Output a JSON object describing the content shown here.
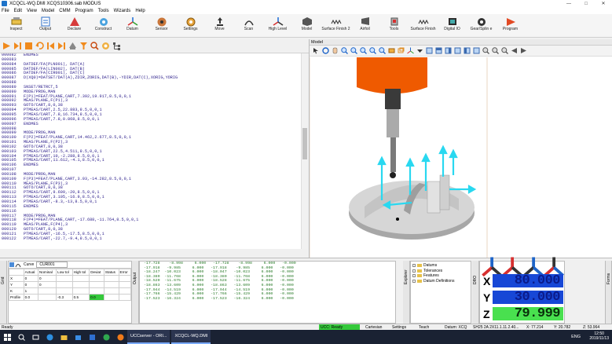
{
  "window": {
    "title": "XCQCL-WQ.DMI   XCQS10306.sab   MODUS",
    "minimize": "—",
    "maximize": "□",
    "close": "✕"
  },
  "menu": [
    "File",
    "Edit",
    "View",
    "Model",
    "CMM",
    "Program",
    "Tools",
    "Wizards",
    "Help"
  ],
  "ribbon": [
    {
      "label": "Inspect",
      "icon": "inspect-icon"
    },
    {
      "label": "Output",
      "icon": "output-icon"
    },
    {
      "label": "Declare",
      "icon": "declare-icon"
    },
    {
      "label": "Construct",
      "icon": "construct-icon"
    },
    {
      "label": "Datum",
      "icon": "datum-icon"
    },
    {
      "label": "Sensor",
      "icon": "sensor-icon"
    },
    {
      "label": "Settings",
      "icon": "settings-icon"
    },
    {
      "label": "Move",
      "icon": "move-icon"
    },
    {
      "label": "Scan",
      "icon": "scan-icon"
    },
    {
      "label": "High Level",
      "icon": "high-level-icon"
    },
    {
      "label": "Model",
      "icon": "model-icon"
    },
    {
      "label": "Surface Finish 2",
      "icon": "surface-finish-2-icon"
    },
    {
      "label": "Airfoil",
      "icon": "airfoil-icon"
    },
    {
      "label": "Tools",
      "icon": "tools-icon"
    },
    {
      "label": "Surface Finish",
      "icon": "surface-finish-icon"
    },
    {
      "label": "Digital IO",
      "icon": "digital-io-icon"
    },
    {
      "label": "Gear/Splin e",
      "icon": "gear-spline-icon"
    },
    {
      "label": "Program",
      "icon": "program-icon"
    }
  ],
  "editor": {
    "lines": [
      "000082   ENDMES",
      "000083",
      "000084   DATDEF/FA(PLN001), DAT(A)",
      "000085   DATDEF/FA(LIN002), DAT(B)",
      "000086   DATDEF/FA(CIR001), DAT(C)",
      "000087   D(XQ0)=DATSET/DAT(A),ZDIR,ZORIG,DAT(B),-YDIR,DAT(C),XORIG,YORIG",
      "000088",
      "000089   SNSET/RETRCT,5",
      "000090   MODE/PROG,MAN",
      "000091   F(P1)=FEAT/PLANE,CART,7.392,19.917,8.5,0,0,1",
      "000092   MEAS/PLANE,F(P1),3",
      "000093   GOTO/CART,8,0,38",
      "000094   PTMEAS/CART,2.5,22.883,8.5,0,0,1",
      "000095   PTMEAS/CART,7.8,16.734,8.5,0,0,1",
      "000096   PTMEAS/CART,7.8,0.868,8.5,0,0,1",
      "000097   ENDMES",
      "000098",
      "000099   MODE/PROG,MAN",
      "000100   F(P2)=FEAT/PLANE,CART,14.462,2.677,8.5,0,0,1",
      "000101   MEAS/PLANE,F(P2),3",
      "000102   GOTO/CART,8,0,38",
      "000103   PTMEAS/CART,22.5,4.511,8.5,0,0,1",
      "000104   PTMEAS/CART,10,-2.288,8.5,0,0,1",
      "000105   PTMEAS/CART,11.612,-4.1,8.5,0,0,1",
      "000106   ENDMES",
      "000107",
      "000108   MODE/PROG,MAN",
      "000109   F(P3)=FEAT/PLANE,CART,3.93,-14.282,8.5,0,0,1",
      "000110   MEAS/PLANE,F(P3),3",
      "000111   GOTO/CART,8,0,38",
      "000112   PTMEAS/CART,9.609,-20,8.5,0,0,1",
      "000113   PTMEAS/CART,3.105,-16.9,8.5,0,0,1",
      "000114   PTMEAS/CART,-8.3,-13,8.5,0,0,1",
      "000115   ENDMES",
      "000116",
      "000117   MODE/PROG,MAN",
      "000118   F(P4)=FEAT/PLANE,CART,-17.688,-11.764,8.5,0,0,1",
      "000119   MEAS/PLANE,F(P4),3",
      "000120   GOTO/CART,8,0,38",
      "000121   PTMEAS/CART,-16.5,-17.5,8.5,0,0,1",
      "000122   PTMEAS/CART,-22.7,-9.4,8.5,0,0,1"
    ]
  },
  "model": {
    "panel_title": "Model"
  },
  "grid": {
    "curve_label": "Curve",
    "curve_value": "CUR001",
    "columns": [
      "",
      "Actual",
      "Nominal",
      "Low tol",
      "High tol",
      "Deviat",
      "Status",
      "Error"
    ],
    "rows": [
      {
        "name": "X",
        "actual": "0",
        "nominal": "0"
      },
      {
        "name": "Y",
        "actual": "0",
        "nominal": "0"
      },
      {
        "name": "K",
        "actual": "1",
        "nominal": ""
      },
      {
        "name": "Profile",
        "actual": "0.0",
        "nominal": "",
        "low": "-0.3",
        "high": "0.5",
        "deviat": "0.0"
      }
    ],
    "side_tab": "Grid"
  },
  "output": {
    "side_tab": "Output",
    "rows": [
      "-17.728    -8.998     6.000   -17.728    -8.998     6.000   -0.000",
      "-17.918   -9.985     6.000   -17.918    -9.985     6.000   -0.000",
      "-18.247  -10.023     6.000   -18.047   -10.023     6.000   -0.000",
      "-18.380  -11.768     6.000   -18.380   -11.768     6.000   -0.000",
      "-18.520  -11.675     6.000   -18.528   -11.675     6.000   -0.000",
      "-18.863  -13.609     6.000   -18.863   -13.609     6.000   -0.000",
      "-17.944  -14.519     6.000   -17.944   -14.519     6.000   -0.000",
      "-17.766  -15.429     6.000   -17.766   -15.429     6.000   -0.000",
      "-17.523  -16.324     6.000   -17.523   -16.324     6.000   -0.000"
    ]
  },
  "explorer": {
    "side_tab": "Explorer",
    "items": [
      "Datums",
      "Tolerances",
      "Features",
      "Datum Definitions"
    ]
  },
  "dro": {
    "side_tab": "DRO",
    "x": "80.000",
    "y": "30.000",
    "z": "79.999",
    "labels": {
      "x": "X",
      "y": "Y",
      "z": "Z"
    },
    "right_tab": "Forms"
  },
  "status": {
    "ready": "Ready",
    "ucc": "UCC: Ready",
    "cartesian": "Cartesian",
    "settings": "Settings",
    "teach": "Teach",
    "datum": "Datum: XCQ",
    "probe": "SH25 2A 2X11.1.11.2.40...",
    "x": "X: 77.214",
    "y": "Y: 20.782",
    "z": "Z: 53.964"
  },
  "taskbar": {
    "apps": [
      "UCCserver - ORI...",
      "XCQCL-WQ.DMI"
    ],
    "lang": "ENG",
    "time": "12:50",
    "date": "2019/11/13"
  }
}
